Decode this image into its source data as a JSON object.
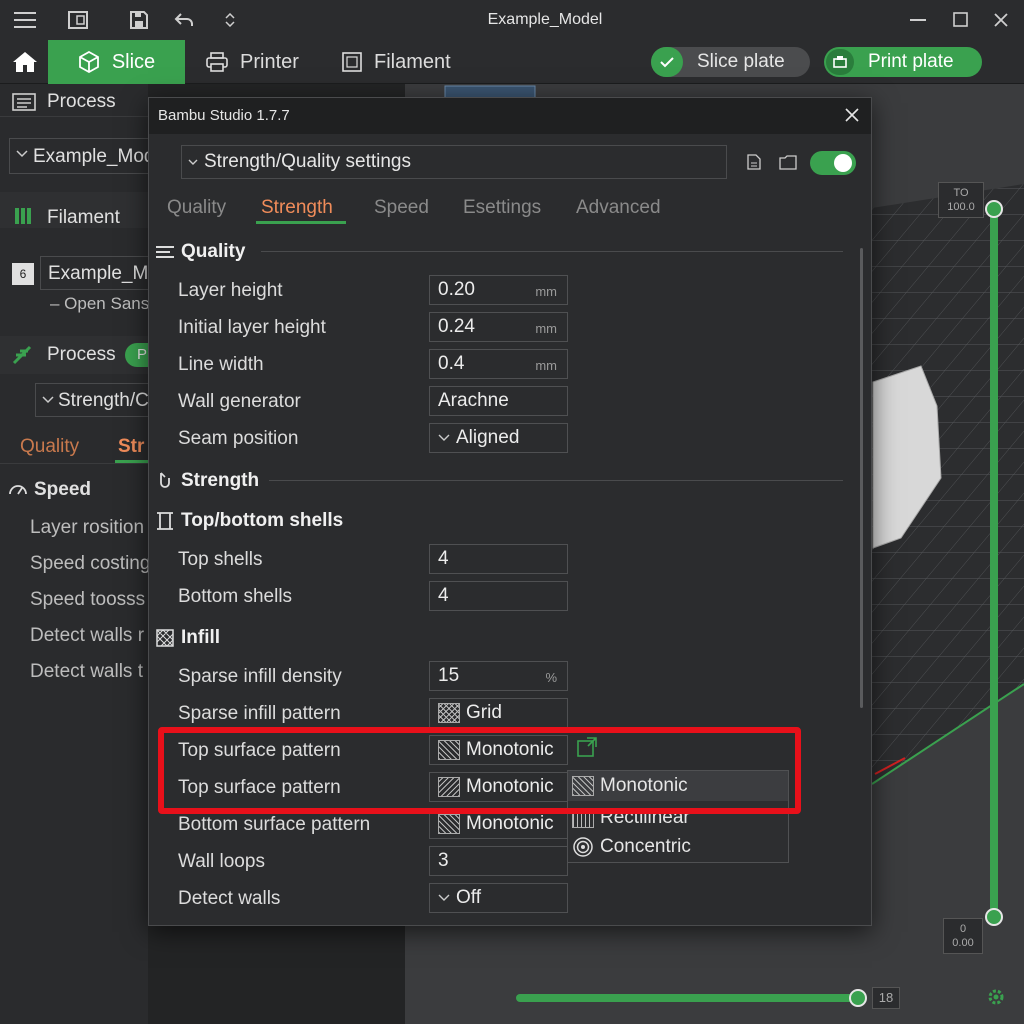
{
  "window": {
    "title": "Example_Model"
  },
  "toolbar": {
    "tabs": [
      {
        "label": "Slice"
      },
      {
        "label": "Printer"
      },
      {
        "label": "Filament"
      }
    ],
    "slice_plate": "Slice plate",
    "print_plate": "Print plate"
  },
  "left_panel": {
    "process_header": "Process",
    "preset_select": "Example_Mod",
    "filament_header": "Filament",
    "filament_badge": "6",
    "filament_name": "Example_M",
    "filament_sub": "– Open Sans",
    "process2_header": "Process",
    "process2_pill": "P",
    "preset2_select": "Strength/C",
    "tabs": [
      "Quality",
      "Str"
    ],
    "speed_header": "Speed",
    "items": [
      "Layer rosition",
      "Speed costing",
      "Speed toosss",
      "Detect walls r",
      "Detect walls t"
    ]
  },
  "dialog": {
    "title": "Bambu Studio 1.7.7",
    "preset": "Strength/Quality settings",
    "tabs": [
      "Quality",
      "Strength",
      "Speed",
      "Esettings",
      "Advanced"
    ],
    "active_tab": "Strength",
    "sections": {
      "quality": "Quality",
      "strength": "Strength",
      "top_bottom": "Top/bottom shells",
      "infill": "Infill"
    },
    "rows": {
      "layer_height": {
        "label": "Layer height",
        "value": "0.20",
        "unit": "mm"
      },
      "initial_layer_height": {
        "label": "Initial layer height",
        "value": "0.24",
        "unit": "mm"
      },
      "line_width": {
        "label": "Line width",
        "value": "0.4",
        "unit": "mm"
      },
      "wall_generator": {
        "label": "Wall generator",
        "value": "Arachne"
      },
      "seam_position": {
        "label": "Seam position",
        "value": "Aligned"
      },
      "top_shells": {
        "label": "Top shells",
        "value": "4"
      },
      "bottom_shells": {
        "label": "Bottom shells",
        "value": "4"
      },
      "sparse_infill_density": {
        "label": "Sparse infill density",
        "value": "15",
        "unit": "%"
      },
      "sparse_infill_pattern": {
        "label": "Sparse infill pattern",
        "value": "Grid"
      },
      "top_surface_pattern": {
        "label": "Top surface pattern",
        "value": "Monotonic"
      },
      "top_surface_pattern_2": {
        "label": "Top surface pattern",
        "value": "Monotonic"
      },
      "bottom_surface_pattern": {
        "label": "Bottom surface pattern",
        "value": "Monotonic"
      },
      "wall_loops": {
        "label": "Wall loops",
        "value": "3"
      },
      "detect_walls": {
        "label": "Detect walls",
        "value": "Off"
      }
    },
    "dropdown_options": [
      "Monotonic",
      "Rectilinear",
      "Concentric"
    ],
    "selected_option": "Monotonic"
  },
  "viewport": {
    "layer_top": "TO",
    "layer_top_value": "100.0",
    "layer_bottom": "0",
    "layer_bottom_value": "0.00",
    "horizontal_value": "18",
    "top_slider_level": 1.0,
    "bottom_slider_level": 0.0,
    "horizontal_slider_level": 1.0
  },
  "colors": {
    "accent": "#3aa14f",
    "active_tab": "#f08c5a",
    "highlight": "#e8101a",
    "background": "#232425"
  }
}
